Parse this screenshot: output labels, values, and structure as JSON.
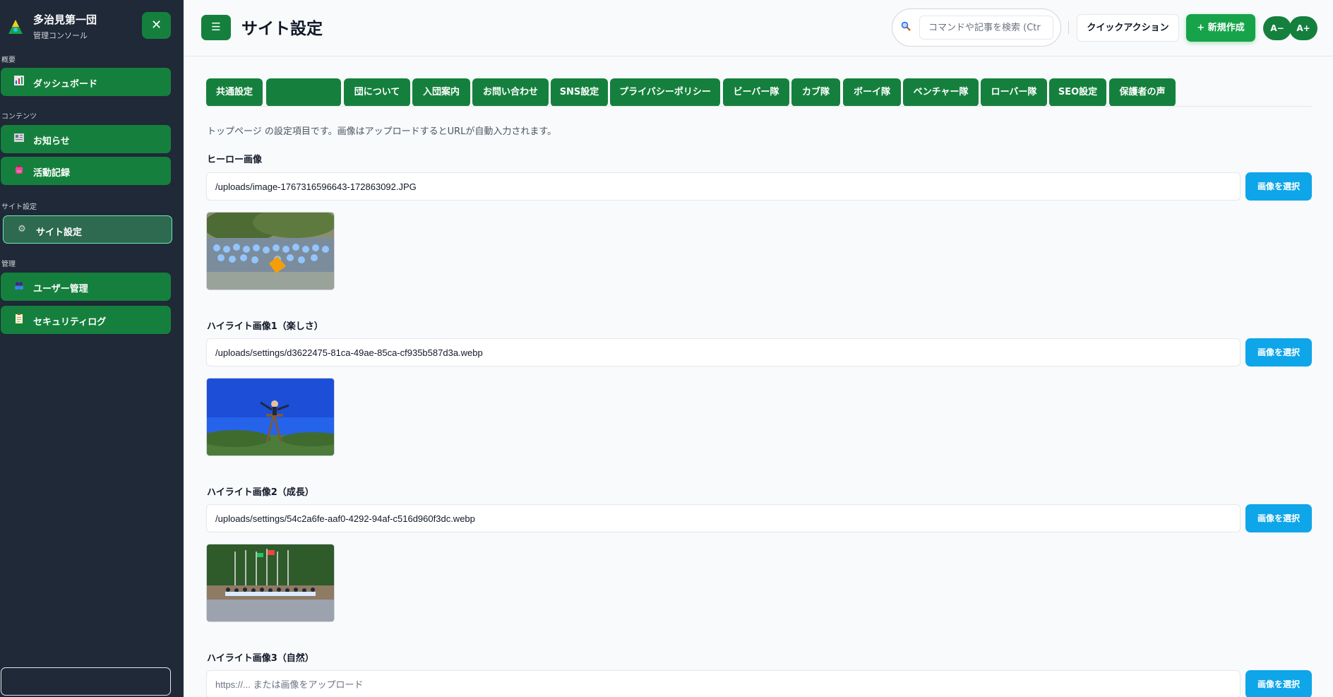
{
  "sidebar": {
    "brand_title": "多治見第一団",
    "brand_sub": "管理コンソール",
    "sections": [
      {
        "label": "概要"
      },
      {
        "label": "コンテンツ"
      },
      {
        "label": "サイト設定"
      },
      {
        "label": "管理"
      }
    ],
    "items": [
      {
        "label": "ダッシュボード",
        "icon": "chart-icon"
      },
      {
        "label": "お知らせ",
        "icon": "newspaper-icon"
      },
      {
        "label": "活動記録",
        "icon": "backpack-icon"
      },
      {
        "label": "サイト設定",
        "icon": "gear-icon",
        "active": true
      },
      {
        "label": "ユーザー管理",
        "icon": "users-icon"
      },
      {
        "label": "セキュリティログ",
        "icon": "clipboard-icon"
      }
    ]
  },
  "header": {
    "title": "サイト設定",
    "search_placeholder": "コマンドや記事を検索 (Ctr",
    "quick_action": "クイックアクション",
    "new_label": "+ 新規作成",
    "font_minus": "A−",
    "font_plus": "A+"
  },
  "tabs": [
    {
      "label": "共通設定"
    },
    {
      "label": ""
    },
    {
      "label": "団について"
    },
    {
      "label": "入団案内"
    },
    {
      "label": "お問い合わせ"
    },
    {
      "label": "SNS設定"
    },
    {
      "label": "プライバシーポリシー"
    },
    {
      "label": "ビーバー隊"
    },
    {
      "label": "カブ隊"
    },
    {
      "label": "ボーイ隊"
    },
    {
      "label": "ベンチャー隊"
    },
    {
      "label": "ローバー隊"
    },
    {
      "label": "SEO設定"
    },
    {
      "label": "保護者の声"
    }
  ],
  "main": {
    "description": "トップページ の設定項目です。画像はアップロードするとURLが自動入力されます。",
    "pick_label": "画像を選択",
    "input_placeholder": "https://... または画像をアップロード",
    "fields": [
      {
        "label": "ヒーロー画像",
        "value": "/uploads/image-1767316596643-172863092.JPG"
      },
      {
        "label": "ハイライト画像1（楽しさ）",
        "value": "/uploads/settings/d3622475-81ca-49ae-85ca-cf935b587d3a.webp"
      },
      {
        "label": "ハイライト画像2（成長）",
        "value": "/uploads/settings/54c2a6fe-aaf0-4292-94af-c516d960f3dc.webp"
      },
      {
        "label": "ハイライト画像3（自然）",
        "value": ""
      }
    ]
  },
  "colors": {
    "sidebar_bg": "#1f2937",
    "primary_green": "#15803d",
    "new_button": "#16a34a",
    "pick_button": "#0ea5e9"
  }
}
